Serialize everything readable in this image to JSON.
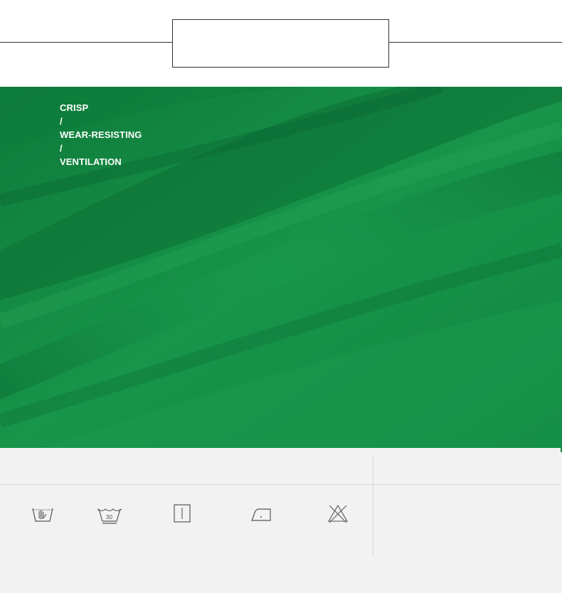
{
  "header": {
    "title": ""
  },
  "fabric": {
    "color": "#148a43",
    "features": [
      "CRISP",
      "/",
      "WEAR-RESISTING",
      "/",
      "VENTILATION"
    ]
  },
  "care": {
    "icons": [
      {
        "name": "hand-wash-icon",
        "label": ""
      },
      {
        "name": "wash-30-icon",
        "label": "30"
      },
      {
        "name": "drip-dry-icon",
        "label": ""
      },
      {
        "name": "iron-low-icon",
        "label": ""
      },
      {
        "name": "do-not-bleach-icon",
        "label": ""
      }
    ]
  }
}
